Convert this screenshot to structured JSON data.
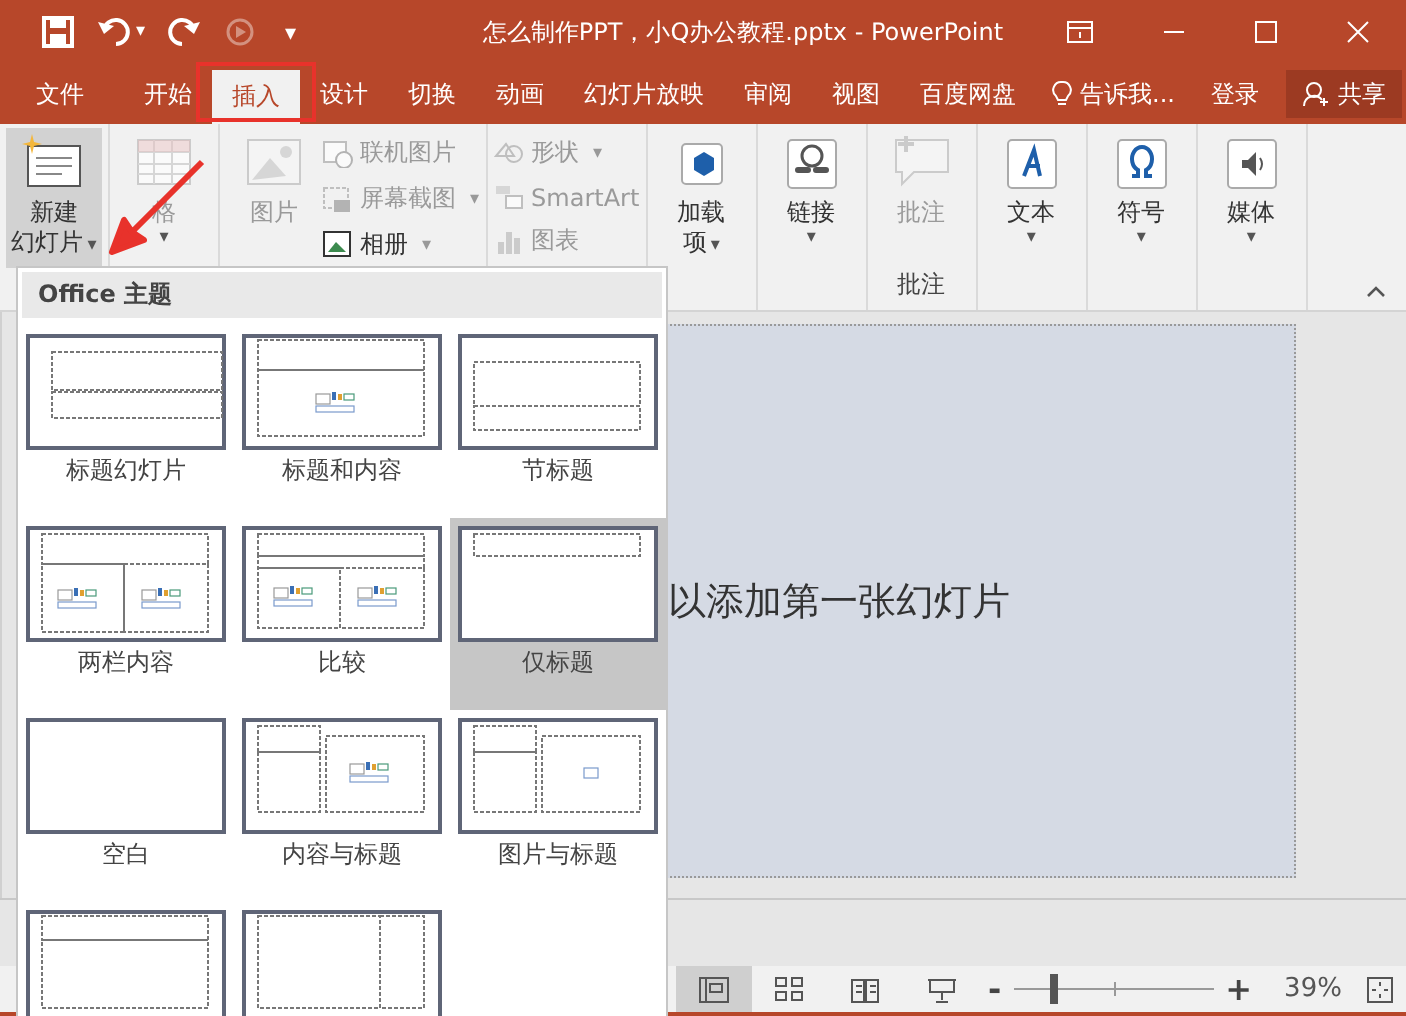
{
  "window": {
    "title": "怎么制作PPT，小Q办公教程.pptx - PowerPoint",
    "quick_access": [
      {
        "disabled": false
      },
      {
        "disabled": false,
        "caret": "▾"
      },
      {
        "disabled": false
      },
      {
        "disabled": true
      }
    ],
    "customize": "▾"
  },
  "tabs": [
    {
      "label": "文件",
      "selected": false
    },
    {
      "label": "开始",
      "selected": false
    },
    {
      "label": "插入",
      "selected": true
    },
    {
      "label": "设计",
      "selected": false
    },
    {
      "label": "切换",
      "selected": false
    },
    {
      "label": "动画",
      "selected": false
    },
    {
      "label": "幻灯片放映",
      "selected": false
    },
    {
      "label": "审阅",
      "selected": false
    },
    {
      "label": "视图",
      "selected": false
    },
    {
      "label": "百度网盘",
      "selected": false
    }
  ],
  "tell_me": "告诉我...",
  "sign_in": "登录",
  "share": "共享",
  "ribbon": {
    "groups": [
      {
        "items": [
          {
            "kind": "large",
            "lines": [
              "新建",
              "幻灯片"
            ],
            "caret": "▾",
            "disabled": false,
            "pressed": true
          }
        ]
      },
      {
        "items": [
          {
            "kind": "large",
            "lines": [
              "格"
            ],
            "caret": "▾",
            "disabled": true,
            "pressed": false
          }
        ]
      },
      {
        "items": [
          {
            "kind": "large",
            "lines": [
              "图片"
            ],
            "disabled": true,
            "pressed": false
          },
          {
            "kind": "stack",
            "items": [
              {
                "label": "联机图片",
                "disabled": true
              },
              {
                "label": "屏幕截图",
                "caret": "▾",
                "disabled": true
              },
              {
                "label": "相册",
                "caret": "▾",
                "disabled": false
              }
            ]
          }
        ]
      },
      {
        "items": [
          {
            "kind": "stack",
            "items": [
              {
                "label": "形状",
                "caret": "▾",
                "disabled": true
              },
              {
                "label": "SmartArt",
                "disabled": true
              },
              {
                "label": "图表",
                "disabled": true
              }
            ]
          }
        ]
      },
      {
        "items": [
          {
            "kind": "large",
            "lines": [
              "加载",
              "项"
            ],
            "caret": "▾",
            "disabled": false,
            "pressed": false
          }
        ]
      },
      {
        "items": [
          {
            "kind": "large",
            "lines": [
              "链接"
            ],
            "caret": "▾",
            "disabled": false,
            "pressed": false
          }
        ]
      },
      {
        "label": "批注",
        "items": [
          {
            "kind": "large",
            "lines": [
              "批注"
            ],
            "disabled": true,
            "pressed": false
          }
        ]
      },
      {
        "items": [
          {
            "kind": "large",
            "lines": [
              "文本"
            ],
            "caret": "▾",
            "disabled": false,
            "pressed": false
          }
        ]
      },
      {
        "items": [
          {
            "kind": "large",
            "lines": [
              "符号"
            ],
            "caret": "▾",
            "disabled": false,
            "pressed": false
          }
        ]
      },
      {
        "items": [
          {
            "kind": "large",
            "lines": [
              "媒体"
            ],
            "caret": "▾",
            "disabled": false,
            "pressed": false
          }
        ]
      }
    ]
  },
  "layout_gallery": {
    "header": "Office 主题",
    "layouts": [
      {
        "kind": "title",
        "label": "标题幻灯片",
        "selected": false
      },
      {
        "kind": "title-content",
        "label": "标题和内容",
        "selected": false
      },
      {
        "kind": "section",
        "label": "节标题",
        "selected": false
      },
      {
        "kind": "two-content",
        "label": "两栏内容",
        "selected": false
      },
      {
        "kind": "comparison",
        "label": "比较",
        "selected": false
      },
      {
        "kind": "title-only",
        "label": "仅标题",
        "selected": true
      },
      {
        "kind": "blank",
        "label": "空白",
        "selected": false
      },
      {
        "kind": "content-caption",
        "label": "内容与标题",
        "selected": false
      },
      {
        "kind": "picture-caption",
        "label": "图片与标题",
        "selected": false
      },
      {
        "kind": "vertical-text",
        "selected": false
      },
      {
        "kind": "vertical-title",
        "selected": false
      }
    ]
  },
  "slide": {
    "placeholder": "以添加第一张幻灯片"
  },
  "status_bar": {
    "views": [
      {
        "selected": true
      },
      {
        "selected": false
      },
      {
        "selected": false
      },
      {
        "selected": false
      }
    ],
    "zoom_out": "-",
    "zoom_in": "+",
    "zoom": {
      "level": 0.2
    },
    "zoom_text": "39%"
  }
}
